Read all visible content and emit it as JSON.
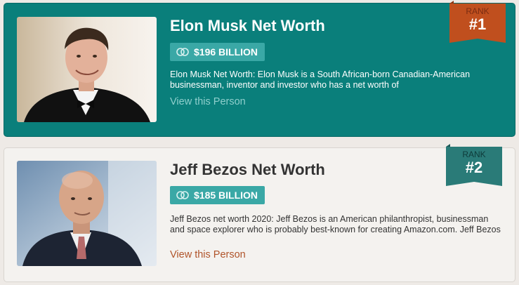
{
  "people": [
    {
      "rank_label": "RANK",
      "rank": "#1",
      "title": "Elon Musk Net Worth",
      "net_worth": "$196 BILLION",
      "description": "Elon Musk Net Worth: Elon Musk is a South African-born Canadian-American businessman, inventor and investor who has a net worth of",
      "link_label": "View this Person",
      "card_color": "#0a7f7b",
      "ribbon_color": "#c04f1e"
    },
    {
      "rank_label": "RANK",
      "rank": "#2",
      "title": "Jeff Bezos Net Worth",
      "net_worth": "$185 BILLION",
      "description": "Jeff Bezos net worth 2020: Jeff Bezos is an American philanthropist, businessman and space explorer who is probably best-known for creating Amazon.com. Jeff Bezos",
      "link_label": "View this Person",
      "card_color": "#f4f2ef",
      "ribbon_color": "#2a7b78"
    }
  ],
  "icons": {
    "net_worth": "coins-icon"
  }
}
